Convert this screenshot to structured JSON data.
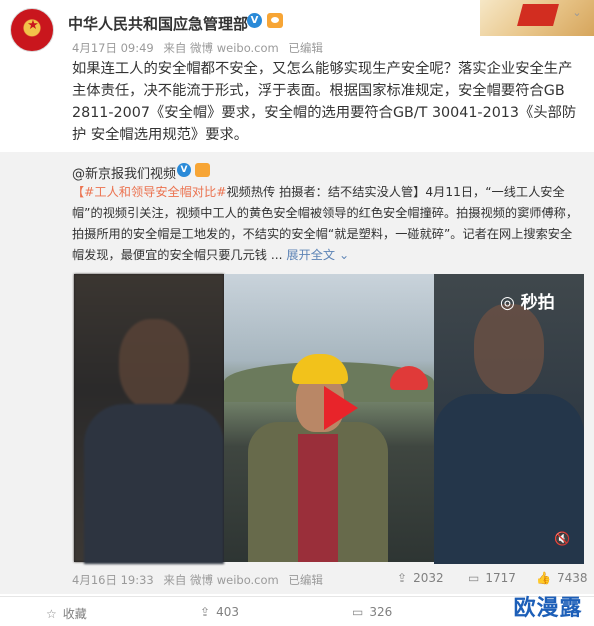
{
  "header": {
    "account_name": "中华人民共和国应急管理部",
    "verified_badge": "V",
    "meta": {
      "date": "4月17日 09:49",
      "source": "来自 微博 weibo.com",
      "status": "已编辑"
    },
    "dropdown_icon": "chevron-down-icon"
  },
  "post": {
    "text": "如果连工人的安全帽都不安全，又怎么能够实现生产安全呢？落实企业安全生产主体责任，决不能流于形式，浮于表面。根据国家标准规定，安全帽要符合GB 2811-2007《安全帽》要求，安全帽的选用要符合GB/T 30041-2013《头部防护 安全帽选用规范》要求。"
  },
  "retweet": {
    "author": "@新京报我们视频",
    "verified_badge": "V",
    "hashtag": "【#工人和领导安全帽对比#",
    "text_a": "视频热传 拍摄者：结不结实没人管】4月11日，",
    "quote": "“一线工人安全帽”",
    "text_b": "的视频引关注，视频中工人的黄色安全帽被领导的红色安全帽撞碎。拍摄视频的窦师傅称，拍摄所用的安全帽是工地发的，不结实的安全帽“就是塑料，一碰就碎”。记者在网上搜索安全帽发现，最便宜的安全帽只要几元钱 ...",
    "expand_label": "展开全文 ⌄",
    "video": {
      "watermark_text": "秒拍",
      "play_icon": "play-icon",
      "mute_icon": "mute-icon"
    },
    "meta": {
      "date": "4月16日 19:33",
      "source": "来自 微博 weibo.com",
      "status": "已编辑"
    },
    "actions": {
      "repost_count": "2032",
      "comment_count": "1717",
      "like_count": "7438"
    }
  },
  "bottom_bar": {
    "favorite_label": "收藏",
    "repost_count": "403",
    "comment_count": "326"
  },
  "watermark": "欧漫露",
  "colors": {
    "link": "#eb7350",
    "expand": "#5d84b6",
    "verified": "#2a8ad8"
  }
}
